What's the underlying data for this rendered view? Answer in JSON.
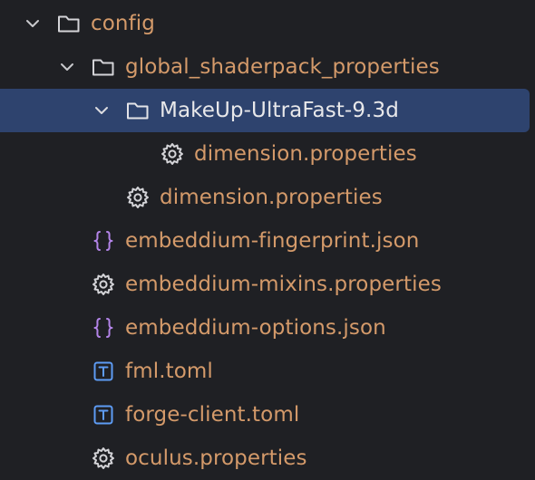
{
  "tree": {
    "items": [
      {
        "label": "config",
        "icon": "folder-icon",
        "expanded": true
      },
      {
        "label": "global_shaderpack_properties",
        "icon": "folder-icon",
        "expanded": true
      },
      {
        "label": "MakeUp-UltraFast-9.3d",
        "icon": "folder-icon",
        "expanded": true,
        "selected": true
      },
      {
        "label": "dimension.properties",
        "icon": "gear-icon"
      },
      {
        "label": "dimension.properties",
        "icon": "gear-icon"
      },
      {
        "label": "embeddium-fingerprint.json",
        "icon": "json-braces-icon"
      },
      {
        "label": "embeddium-mixins.properties",
        "icon": "gear-icon"
      },
      {
        "label": "embeddium-options.json",
        "icon": "json-braces-icon"
      },
      {
        "label": "fml.toml",
        "icon": "toml-text-icon"
      },
      {
        "label": "forge-client.toml",
        "icon": "toml-text-icon"
      },
      {
        "label": "oculus.properties",
        "icon": "gear-icon"
      }
    ]
  },
  "colors": {
    "background": "#1f2024",
    "selection": "#2e436e",
    "label": "#d49a6a",
    "selected_label": "#e8e8ea",
    "json_icon": "#b384e8",
    "toml_icon": "#5e9cf5",
    "neutral_icon": "#d4d4d8"
  }
}
